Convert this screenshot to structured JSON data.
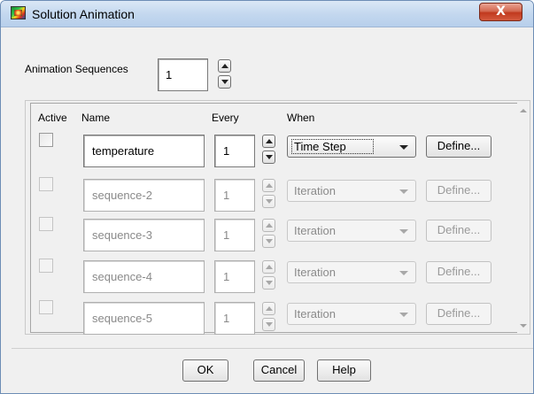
{
  "window": {
    "title": "Solution Animation",
    "close_label": "X"
  },
  "sequences": {
    "label": "Animation Sequences",
    "count": "1"
  },
  "table": {
    "headers": {
      "active": "Active",
      "name": "Name",
      "every": "Every",
      "when": "When"
    },
    "rows": [
      {
        "name": "temperature",
        "every": "1",
        "when": "Time Step",
        "define": "Define...",
        "enabled": true
      },
      {
        "name": "sequence-2",
        "every": "1",
        "when": "Iteration",
        "define": "Define...",
        "enabled": false
      },
      {
        "name": "sequence-3",
        "every": "1",
        "when": "Iteration",
        "define": "Define...",
        "enabled": false
      },
      {
        "name": "sequence-4",
        "every": "1",
        "when": "Iteration",
        "define": "Define...",
        "enabled": false
      },
      {
        "name": "sequence-5",
        "every": "1",
        "when": "Iteration",
        "define": "Define...",
        "enabled": false
      }
    ]
  },
  "buttons": {
    "ok": "OK",
    "cancel": "Cancel",
    "help": "Help"
  }
}
